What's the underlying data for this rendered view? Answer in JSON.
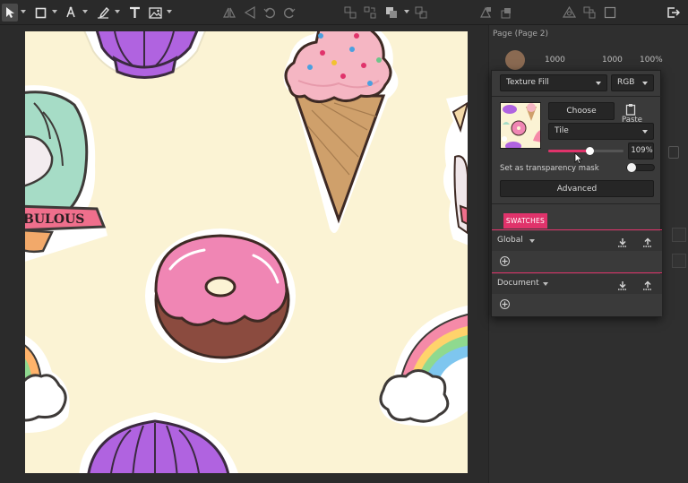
{
  "toolbar": {
    "tools": [
      "pointer-icon",
      "rectangle-icon",
      "pen-icon",
      "brush-icon",
      "text-icon",
      "image-icon"
    ],
    "actions": [
      "flip-icon",
      "rotate-icon",
      "undo-icon",
      "redo-icon",
      "group-icon",
      "ungroup-icon",
      "arrange-icon",
      "boolean-icon",
      "mask-icon",
      "symbol-icon",
      "component-icon",
      "frame-icon",
      "export-icon"
    ]
  },
  "panel": {
    "page_label": "Page (Page 2)",
    "width": "1000",
    "height": "1000",
    "zoom": "100%"
  },
  "fill_popup": {
    "fill_type": "Texture Fill",
    "color_mode": "RGB",
    "choose_image_label": "Choose Image...",
    "paste_label": "Paste",
    "mode": "Tile",
    "scale_percent": 109,
    "scale_value": "109%",
    "transparency_mask_label": "Set as transparency mask",
    "advanced_label": "Advanced"
  },
  "swatches": {
    "tab_label": "SWATCHES",
    "groups": [
      {
        "label": "Global"
      },
      {
        "label": "Document"
      }
    ]
  },
  "artboard": {
    "banner_text": "BULOUS",
    "background_color": "#fbf3d4",
    "accent_color": "#e0336b"
  }
}
